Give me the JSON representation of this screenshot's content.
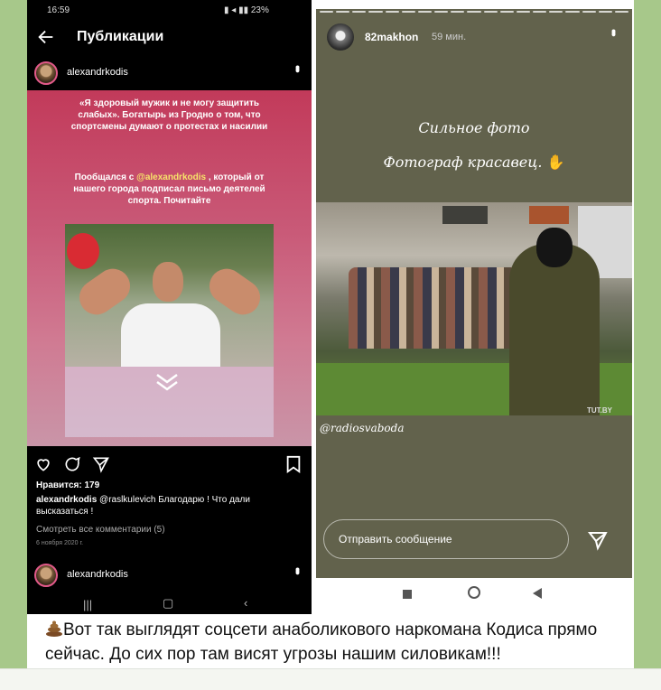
{
  "left_phone": {
    "status": {
      "time": "16:59",
      "battery": "23%"
    },
    "header": {
      "title": "Публикации"
    },
    "post_author": "alexandrkodis",
    "post_text_1": "«Я здоровый мужик и не могу защитить слабых». Богатырь из Гродно о том, что спортсмены думают о протестах и насилии",
    "post_text_2_pre": "Пообщался с ",
    "post_text_2_mention": "@alexandrkodis",
    "post_text_2_post": " , который от  нашего города подписал письмо деятелей спорта.  Почитайте",
    "likes": "Нравится: 179",
    "caption_user": "alexandrkodis",
    "caption_text": " @raslkulevich Благодарю ! Что дали высказаться !",
    "view_comments": "Смотреть все комментарии (5)",
    "date": "6 ноября 2020 г.",
    "next_author": "alexandrkodis"
  },
  "right_phone": {
    "story_user": "82makhon",
    "story_time": "59 мин.",
    "line1": "Сильное фото",
    "line2": "Фотограф красавец.",
    "photo_watermark": "TUT.BY",
    "tag": "@radiosvaboda",
    "message_placeholder": "Отправить сообщение"
  },
  "telegram_caption": "Вот так выглядят соцсети анаболикового наркомана Кодиса прямо сейчас. До сих пор там висят угрозы нашим силовикам!!!",
  "colors": {
    "story_bg": "#62624c",
    "post_gradient": "#c23a5a",
    "mention": "#f6e36a",
    "chat_bg": "#a7c88a"
  }
}
